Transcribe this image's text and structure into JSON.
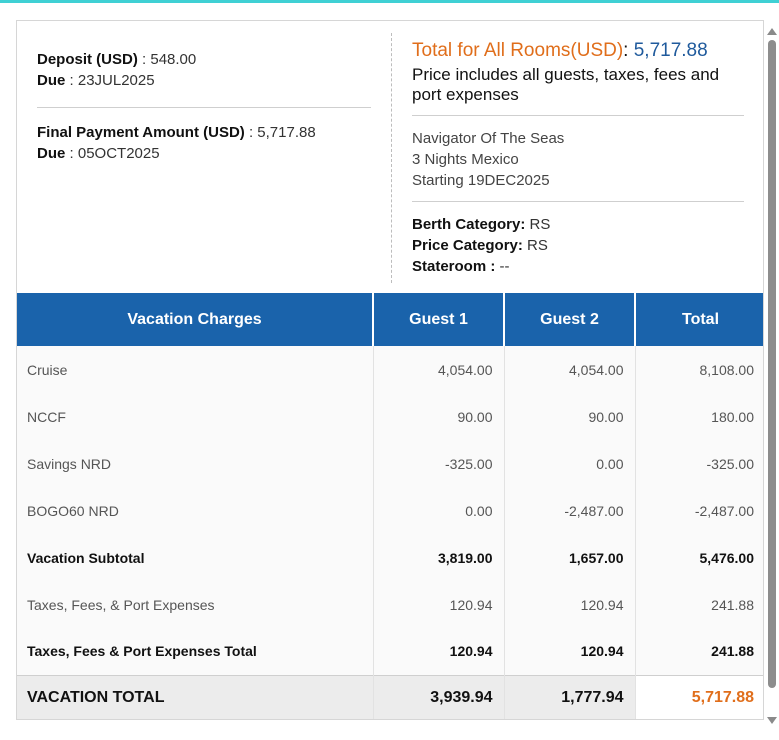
{
  "deposit": {
    "label": "Deposit (USD)",
    "value": " : 548.00",
    "due_label": "Due",
    "due_value": " : 23JUL2025"
  },
  "final_payment": {
    "label": "Final Payment Amount (USD)",
    "value": " : 5,717.88",
    "due_label": "Due",
    "due_value": " : 05OCT2025"
  },
  "total": {
    "label": "Total for All Rooms(USD)",
    "separator": ": ",
    "value": "5,717.88",
    "includes": "Price includes all guests, taxes, fees and port expenses"
  },
  "ship": {
    "name": "Navigator Of The Seas",
    "itinerary": "3 Nights Mexico",
    "start": "Starting 19DEC2025"
  },
  "categories": {
    "berth_label": "Berth Category:",
    "berth_value": " RS",
    "price_label": "Price Category:",
    "price_value": " RS",
    "stateroom_label": "Stateroom :",
    "stateroom_value": " --"
  },
  "table": {
    "headers": [
      "Vacation Charges",
      "Guest 1",
      "Guest 2",
      "Total"
    ],
    "rows": [
      [
        "Cruise",
        "4,054.00",
        "4,054.00",
        "8,108.00"
      ],
      [
        "NCCF",
        "90.00",
        "90.00",
        "180.00"
      ],
      [
        "Savings NRD",
        "-325.00",
        "0.00",
        "-325.00"
      ],
      [
        "BOGO60 NRD",
        "0.00",
        "-2,487.00",
        "-2,487.00"
      ],
      [
        "Vacation Subtotal",
        "3,819.00",
        "1,657.00",
        "5,476.00"
      ],
      [
        "Taxes, Fees, & Port Expenses",
        "120.94",
        "120.94",
        "241.88"
      ],
      [
        "Taxes, Fees & Port Expenses Total",
        "120.94",
        "120.94",
        "241.88"
      ]
    ],
    "grand": [
      "VACATION TOTAL",
      "3,939.94",
      "1,777.94",
      "5,717.88"
    ]
  },
  "colors": {
    "header_blue": "#1a63ab",
    "accent_orange": "#e06e1b",
    "total_blue": "#1f5a9c"
  }
}
